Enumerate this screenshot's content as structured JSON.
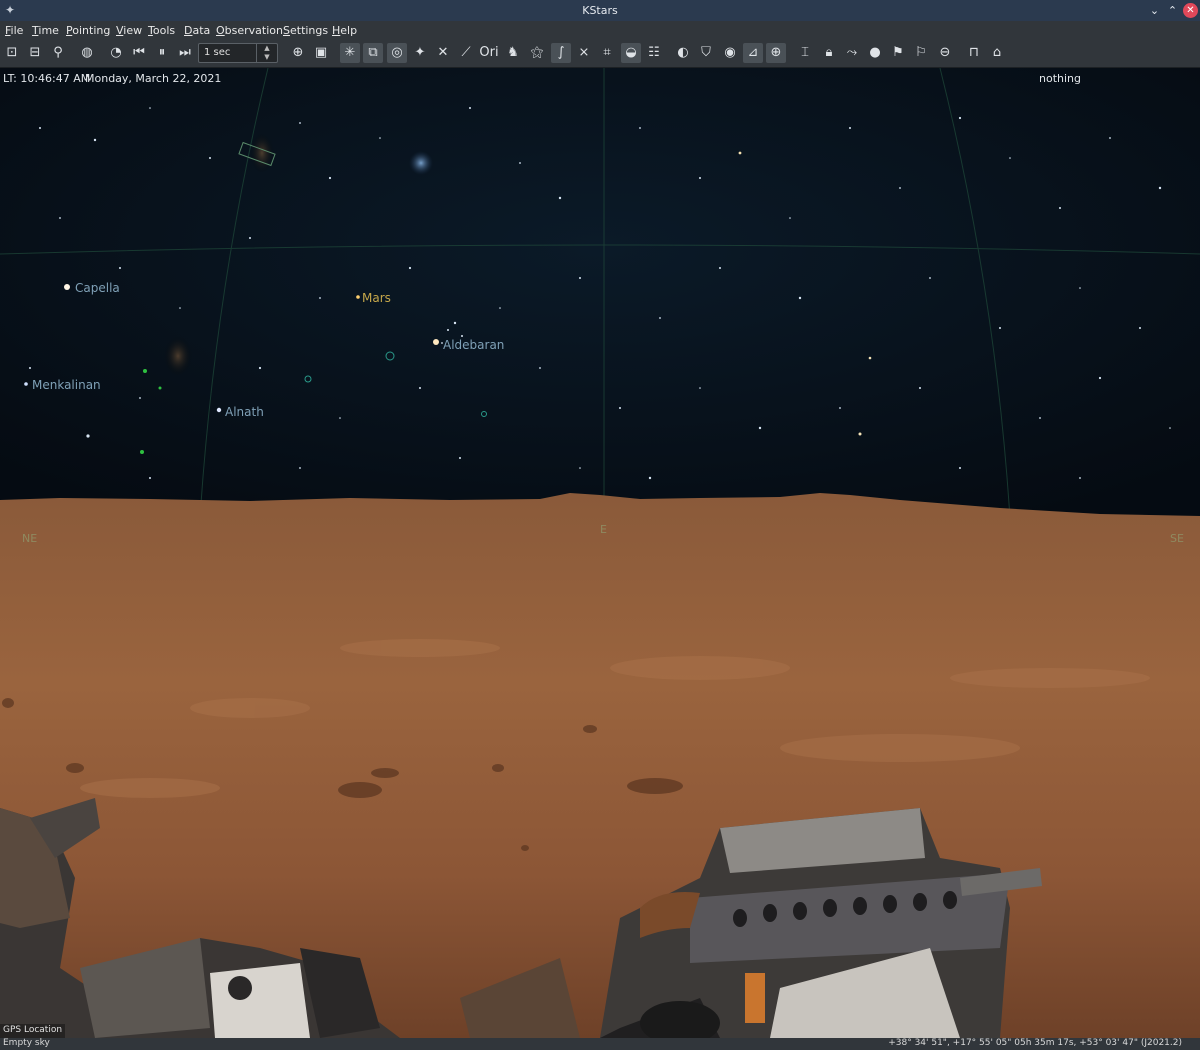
{
  "window": {
    "title": "KStars",
    "app_icon": "telescope-icon"
  },
  "menu": [
    {
      "mnemonic": "F",
      "rest": "ile"
    },
    {
      "mnemonic": "T",
      "rest": "ime"
    },
    {
      "mnemonic": "P",
      "rest": "ointing"
    },
    {
      "mnemonic": "V",
      "rest": "iew"
    },
    {
      "mnemonic": "T",
      "rest": "ools"
    },
    {
      "mnemonic": "D",
      "rest": "ata"
    },
    {
      "mnemonic": "O",
      "rest": "bservation"
    },
    {
      "mnemonic": "S",
      "rest": "ettings"
    },
    {
      "mnemonic": "H",
      "rest": "elp"
    }
  ],
  "toolbar": {
    "time_step": "1 sec",
    "icons": [
      "zoom-in-icon",
      "zoom-out-icon",
      "find-object-icon",
      "globe-icon",
      "clock-icon",
      "step-back-icon",
      "pause-icon",
      "step-forward-icon",
      "time-step-spinbox",
      "center-track-icon",
      "image-icon",
      "stars-toggle-icon",
      "deep-sky-toggle-icon",
      "constellation-toggle-icon",
      "solar-system-icon",
      "satellites-icon",
      "constellation-lines-icon",
      "constellation-names-icon",
      "milky-way-icon",
      "equatorial-grid-icon",
      "horizontal-grid-icon",
      "ecliptic-icon",
      "horizon-icon",
      "ground-icon",
      "supernovae-icon",
      "flags-icon",
      "hips-icon",
      "observation-list-icon",
      "fov-symbols-icon",
      "crosshair-icon",
      "telescope-icon",
      "lock-icon",
      "projection-icon",
      "circle-icon",
      "flag-icon",
      "flag-alt-icon",
      "ban-icon",
      "scope-mount-icon",
      "scope-dome-icon"
    ]
  },
  "sky": {
    "local_time": "LT: 10:46:47 AM",
    "date": "Monday, March 22, 2021",
    "focus_object": "nothing",
    "labels": {
      "capella": "Capella",
      "mars": "Mars",
      "aldebaran": "Aldebaran",
      "menkalinan": "Menkalinan",
      "alnath": "Alnath"
    },
    "compass": {
      "ne": "NE",
      "e": "E",
      "se": "SE"
    },
    "gps": "GPS Location"
  },
  "status": {
    "left": "Empty sky",
    "right": "+38° 34' 51\", +17° 55' 05\"  05h 35m 17s, +53° 03' 47\" (J2021.2)"
  }
}
